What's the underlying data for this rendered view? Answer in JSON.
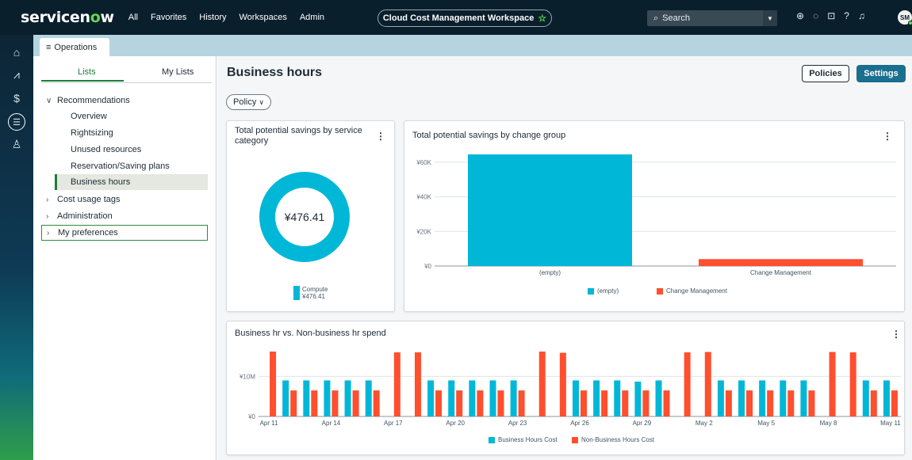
{
  "topnav": {
    "logo_pre": "servicen",
    "logo_o": "o",
    "logo_post": "w",
    "links": [
      "All",
      "Favorites",
      "History",
      "Workspaces",
      "Admin"
    ],
    "workspace_title": "Cloud Cost Management Workspace",
    "search_placeholder": "Search",
    "avatar_initials": "SM"
  },
  "tab": {
    "label": "Operations"
  },
  "sidebar": {
    "tabs": {
      "lists": "Lists",
      "my_lists": "My Lists"
    },
    "recommendations": "Recommendations",
    "children": [
      "Overview",
      "Rightsizing",
      "Unused resources",
      "Reservation/Saving plans",
      "Business hours"
    ],
    "cost_usage_tags": "Cost usage tags",
    "administration": "Administration",
    "my_preferences": "My preferences"
  },
  "main": {
    "title": "Business hours",
    "policies_button": "Policies",
    "settings_button": "Settings",
    "policy_filter": "Policy"
  },
  "card1": {
    "title": "Total potential savings by service category",
    "center_value": "¥476.41",
    "legend_label": "Compute",
    "legend_value": "¥476.41"
  },
  "card2": {
    "title": "Total potential savings by change group"
  },
  "card3": {
    "title": "Business hr vs. Non-business hr spend"
  },
  "colors": {
    "cyan": "#00b7d7",
    "orange": "#ff4f2e",
    "green": "#1e7d3b",
    "nav": "#0a1f2c"
  },
  "chart_data": [
    {
      "type": "bar",
      "title": "Total potential savings by change group",
      "categories": [
        "(empty)",
        "Change Management"
      ],
      "values": [
        64500,
        4000
      ],
      "ylim": [
        0,
        70000
      ],
      "yticks": [
        0,
        20000,
        40000,
        60000
      ],
      "ytick_labels": [
        "¥0",
        "¥20K",
        "¥40K",
        "¥60K"
      ],
      "series_colors": [
        "#00b7d7",
        "#ff4f2e"
      ],
      "legend": [
        "(empty)",
        "Change Management"
      ],
      "grid": true
    },
    {
      "type": "bar",
      "title": "Business hr vs. Non-business hr spend",
      "categories": [
        "Apr 11",
        "Apr 12",
        "Apr 13",
        "Apr 14",
        "Apr 15",
        "Apr 16",
        "Apr 17",
        "Apr 18",
        "Apr 19",
        "Apr 20",
        "Apr 21",
        "Apr 22",
        "Apr 23",
        "Apr 24",
        "Apr 25",
        "Apr 26",
        "Apr 27",
        "Apr 28",
        "Apr 29",
        "Apr 30",
        "May 1",
        "May 2",
        "May 3",
        "May 4",
        "May 5",
        "May 6",
        "May 7",
        "May 8",
        "May 9",
        "May 10",
        "May 11"
      ],
      "x_tick_labels": [
        "Apr 11",
        "Apr 14",
        "Apr 17",
        "Apr 20",
        "Apr 23",
        "Apr 26",
        "Apr 29",
        "May 2",
        "May 5",
        "May 8",
        "May 11"
      ],
      "series": [
        {
          "name": "Business Hours Cost",
          "color": "#00b7d7",
          "values": [
            0,
            9,
            9,
            9,
            9,
            9,
            0,
            0,
            9,
            9,
            9,
            9,
            9,
            0,
            0,
            9,
            9,
            9,
            8.7,
            9,
            0,
            0,
            9,
            9,
            9,
            9,
            9,
            0,
            0,
            9,
            9
          ]
        },
        {
          "name": "Non-Business Hours Cost",
          "color": "#ff4f2e",
          "values": [
            16.2,
            6.5,
            6.5,
            6.5,
            6.5,
            6.5,
            16,
            16,
            6.5,
            6.5,
            6.5,
            6.5,
            6.5,
            16.2,
            15.9,
            6.5,
            6.5,
            6.5,
            6.5,
            6.5,
            16,
            16.1,
            6.5,
            6.5,
            6.5,
            6.5,
            6.5,
            16.1,
            16,
            6.5,
            6.5
          ]
        }
      ],
      "y_unit": "million yen",
      "ylim": [
        0,
        17
      ],
      "yticks": [
        0,
        10
      ],
      "ytick_labels": [
        "¥0",
        "¥10M"
      ],
      "grid": true
    }
  ]
}
